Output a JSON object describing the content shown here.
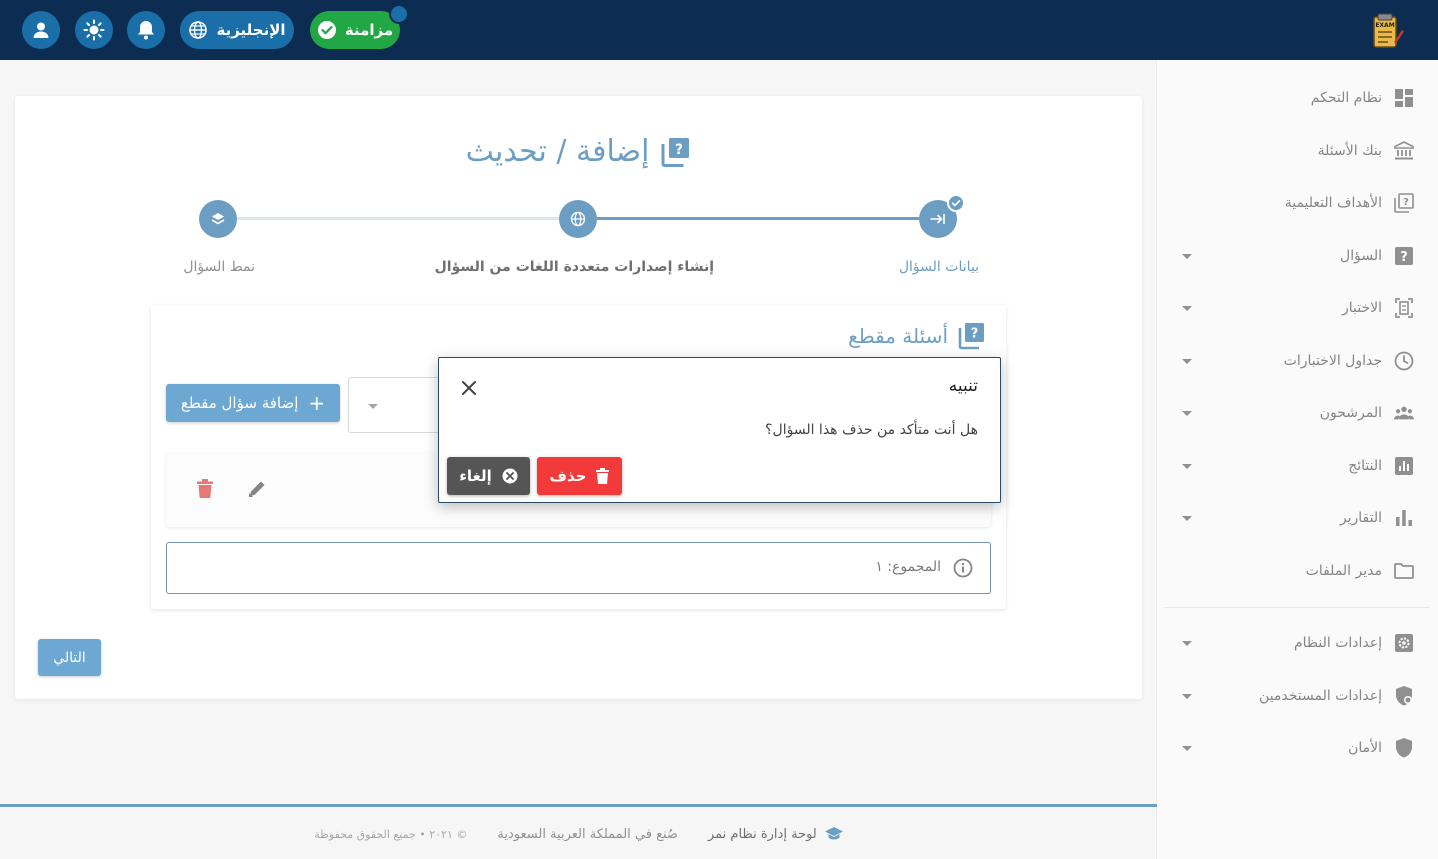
{
  "topbar": {
    "sync_label": "مزامنة",
    "language_label": "الإنجليزية",
    "logo_text": "EXAM"
  },
  "sidebar": {
    "items": [
      {
        "label": "نظام التحكم",
        "icon": "dashboard-icon"
      },
      {
        "label": "بنك الأسئلة",
        "icon": "bank-icon"
      },
      {
        "label": "الأهداف التعليمية",
        "icon": "book-icon"
      },
      {
        "label": "السؤال",
        "icon": "question-icon"
      },
      {
        "label": "الاختبار",
        "icon": "exam-icon"
      },
      {
        "label": "جداول الاختبارات",
        "icon": "clock-icon"
      },
      {
        "label": "المرشحون",
        "icon": "people-icon"
      },
      {
        "label": "النتائج",
        "icon": "results-icon"
      },
      {
        "label": "التقارير",
        "icon": "bar-chart-icon"
      },
      {
        "label": "مدير الملفات",
        "icon": "folder-icon"
      },
      {
        "label": "إعدادات النظام",
        "icon": "settings-icon"
      },
      {
        "label": "إعدادات المستخدمين",
        "icon": "user-shield-icon"
      },
      {
        "label": "الأمان",
        "icon": "shield-icon"
      }
    ]
  },
  "main": {
    "title": "إضافة / تحديث",
    "steps": [
      {
        "label": "بيانات السؤال",
        "state": "completed"
      },
      {
        "label": "إنشاء إصدارات متعددة اللغات من السؤال",
        "state": "active"
      },
      {
        "label": "نمط السؤال",
        "state": "pending"
      }
    ],
    "section_title": "أسئلة مقطع",
    "add_button_label": "إضافة سؤال مقطع",
    "total_label": "المجموع: ١",
    "next_button_label": "التالي"
  },
  "dialog": {
    "title": "تنبيه",
    "message": "هل أنت متأكد من حذف هذا السؤال؟",
    "delete_label": "حذف",
    "cancel_label": "إلغاء"
  },
  "footer": {
    "brand": "لوحة إدارة نظام نمر",
    "made_in": "صُنع في المملكة العربية السعودية",
    "copyright": "© ٢٠٢١ • جميع الحقوق محفوظة"
  },
  "colors": {
    "topbar": "#0c2c52",
    "primary": "#1e6aa3",
    "sync": "#22a745",
    "danger": "#f33a3a",
    "cancel": "#555555"
  }
}
